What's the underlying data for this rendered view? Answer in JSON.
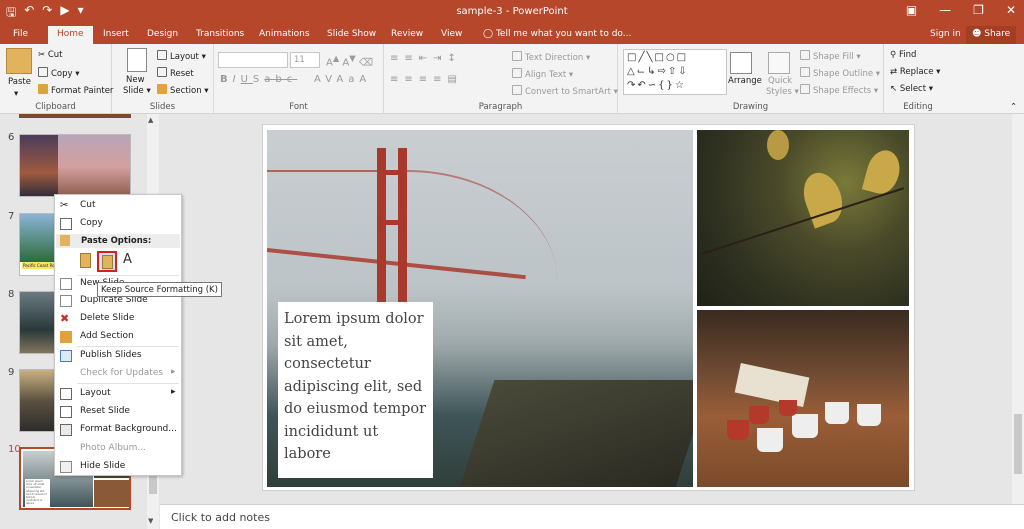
{
  "window": {
    "title": "sample-3 - PowerPoint",
    "sign_in": "Sign in",
    "share": "Share"
  },
  "tabs": [
    "File",
    "Home",
    "Insert",
    "Design",
    "Transitions",
    "Animations",
    "Slide Show",
    "Review",
    "View"
  ],
  "tell_me": "Tell me what you want to do...",
  "ribbon": {
    "clipboard": {
      "label": "Clipboard",
      "paste": "Paste",
      "cut": "Cut",
      "copy": "Copy",
      "format_painter": "Format Painter"
    },
    "slides": {
      "label": "Slides",
      "new_slide_1": "New",
      "new_slide_2": "Slide",
      "layout": "Layout",
      "reset": "Reset",
      "section": "Section"
    },
    "font": {
      "label": "Font",
      "size": "11"
    },
    "paragraph": {
      "label": "Paragraph",
      "text_direction": "Text Direction",
      "align_text": "Align Text",
      "convert_smartart": "Convert to SmartArt"
    },
    "drawing": {
      "label": "Drawing",
      "arrange": "Arrange",
      "quick_styles_1": "Quick",
      "quick_styles_2": "Styles",
      "shape_fill": "Shape Fill",
      "shape_outline": "Shape Outline",
      "shape_effects": "Shape Effects"
    },
    "editing": {
      "label": "Editing",
      "find": "Find",
      "replace": "Replace",
      "select": "Select"
    }
  },
  "thumbnails": [
    {
      "num": "6"
    },
    {
      "num": "7",
      "caption": "Pacific Coast Road"
    },
    {
      "num": "8"
    },
    {
      "num": "9"
    },
    {
      "num": "10",
      "text": "Lorem ipsum dolor sit amet, consectetur adipiscing elit, sed do eiusmod tempor incididunt ut labore"
    }
  ],
  "context_menu": {
    "cut": "Cut",
    "copy": "Copy",
    "paste_options": "Paste Options:",
    "new_slide": "New Slide",
    "duplicate_slide": "Duplicate Slide",
    "delete_slide": "Delete Slide",
    "add_section": "Add Section",
    "publish_slides": "Publish Slides",
    "check_updates": "Check for Updates",
    "layout": "Layout",
    "reset_slide": "Reset Slide",
    "format_background": "Format Background...",
    "photo_album": "Photo Album...",
    "hide_slide": "Hide Slide"
  },
  "tooltip": "Keep Source Formatting (K)",
  "slide": {
    "text": "Lorem ipsum dolor sit amet, consectetur adipiscing elit, sed do eiusmod tempor incididunt ut labore"
  },
  "notes": "Click to add notes",
  "colors": {
    "accent": "#b7472a",
    "highlight": "#d32020"
  }
}
